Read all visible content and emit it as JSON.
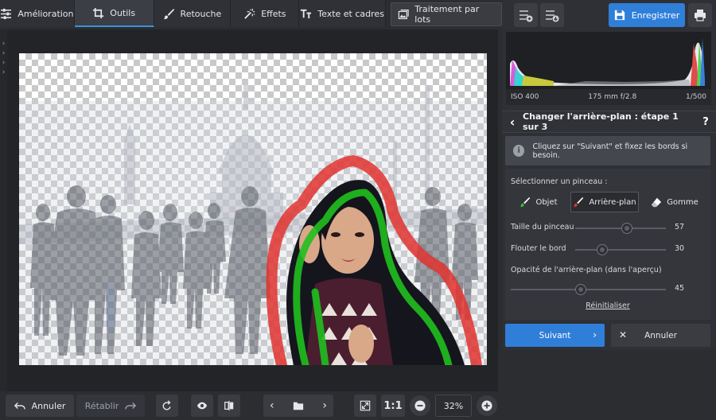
{
  "toolbar": {
    "tabs": [
      {
        "label": "Amélioration",
        "icon": "sliders-icon"
      },
      {
        "label": "Outils",
        "icon": "crop-icon"
      },
      {
        "label": "Retouche",
        "icon": "brush-icon"
      },
      {
        "label": "Effets",
        "icon": "magic-wand-icon"
      },
      {
        "label": "Texte et cadres",
        "icon": "text-icon"
      }
    ],
    "batch_label": "Traitement par lots",
    "active_tab": "Outils"
  },
  "header": {
    "save_label": "Enregistrer"
  },
  "histogram": {
    "iso": "ISO 400",
    "lens": "175 mm f/2.8",
    "shutter": "1/500"
  },
  "step": {
    "title": "Changer l'arrière-plan : étape 1 sur 3",
    "help": "?",
    "info_text": "Cliquez sur \"Suivant\" et fixez les bords si besoin."
  },
  "brush": {
    "select_label": "Sélectionner un pinceau :",
    "options": [
      "Objet",
      "Arrière-plan",
      "Gomme"
    ],
    "selected": "Arrière-plan",
    "size_label": "Taille du pinceau",
    "size_value": "57",
    "size_fraction": 0.57,
    "blur_label": "Flouter le bord",
    "blur_value": "30",
    "blur_fraction": 0.3,
    "opacity_label": "Opacité de l'arrière-plan (dans l'aperçu)",
    "opacity_value": "45",
    "opacity_fraction": 0.45,
    "reset_label": "Réinitialiser"
  },
  "actions": {
    "next_label": "Suivant",
    "cancel_label": "Annuler"
  },
  "bottom": {
    "undo_label": "Annuler",
    "redo_label": "Rétablir",
    "ratio_label": "1:1",
    "zoom": "32%"
  },
  "colors": {
    "accent": "#2f7fd9",
    "object_stroke": "#1fbf1f",
    "background_stroke": "#e0332f"
  }
}
